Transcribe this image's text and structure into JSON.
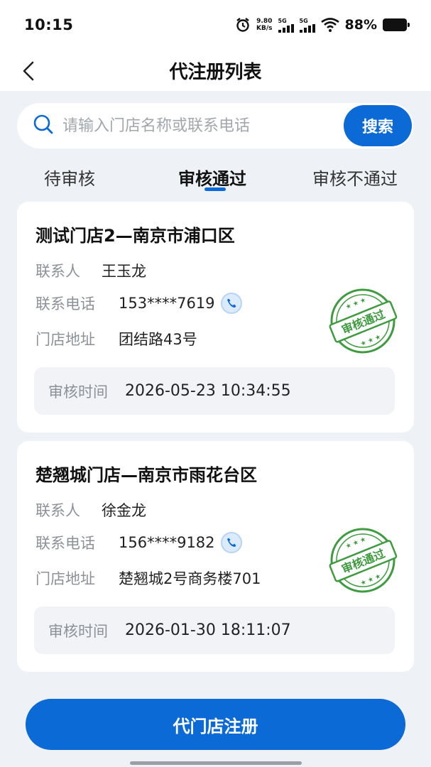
{
  "status_bar": {
    "time": "10:15",
    "net_speed_value": "9.80",
    "net_speed_unit": "KB/s",
    "sim1": "5G",
    "sim2": "5G",
    "battery": "88%"
  },
  "header": {
    "title": "代注册列表"
  },
  "search": {
    "placeholder": "请输入门店名称或联系电话",
    "value": "",
    "button_label": "搜索"
  },
  "tabs": [
    {
      "label": "待审核",
      "active": false
    },
    {
      "label": "审核通过",
      "active": true
    },
    {
      "label": "审核不通过",
      "active": false
    }
  ],
  "cards": [
    {
      "title": "测试门店2—南京市浦口区",
      "contact_label": "联系人",
      "contact": "王玉龙",
      "phone_label": "联系电话",
      "phone": "153****7619",
      "address_label": "门店地址",
      "address": "团结路43号",
      "review_time_label": "审核时间",
      "review_time": "2026-05-23 10:34:55",
      "stamp": "审核通过"
    },
    {
      "title": "楚翘城门店—南京市雨花台区",
      "contact_label": "联系人",
      "contact": "徐金龙",
      "phone_label": "联系电话",
      "phone": "156****9182",
      "address_label": "门店地址",
      "address": "楚翘城2号商务楼701",
      "review_time_label": "审核时间",
      "review_time": "2026-01-30 18:11:07",
      "stamp": "审核通过"
    }
  ],
  "bottom_button": {
    "label": "代门店注册"
  },
  "colors": {
    "accent": "#0b6ad6",
    "stamp_green": "#3f9b3f",
    "background": "#eef1f5"
  }
}
